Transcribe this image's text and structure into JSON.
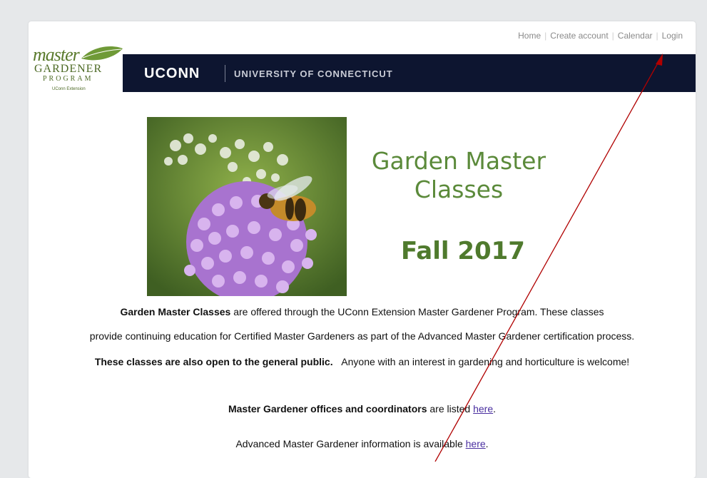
{
  "nav": {
    "home": "Home",
    "create_account": "Create account",
    "calendar": "Calendar",
    "login": "Login",
    "separator": "|"
  },
  "logo": {
    "script": "master",
    "gardener": "GARDENER",
    "program": "PROGRAM",
    "extension": "UConn Extension"
  },
  "brand": {
    "uconn": "UCONN",
    "university": "UNIVERSITY OF CONNECTICUT"
  },
  "hero": {
    "title": "Garden Master Classes",
    "season": "Fall 2017"
  },
  "intro": {
    "line1_bold": "Garden Master Classes",
    "line1_rest": " are offered through the UConn Extension Master Gardener Program. These classes",
    "line2": "provide continuing education for Certified Master Gardeners as part of the Advanced Master Gardener certification process.",
    "line3_bold": "These classes are also open to the general public.",
    "line3_rest": "Anyone with an interest in gardening and horticulture is welcome!"
  },
  "info": {
    "offices_bold": "Master Gardener offices and coordinators",
    "offices_rest": " are listed ",
    "offices_link": "here",
    "offices_end": ".",
    "amg_text": "Advanced Master Gardener information is available ",
    "amg_link": "here",
    "amg_end": "."
  },
  "colors": {
    "title_green": "#5b8a3a",
    "brand_navy": "#0d1530",
    "annotation_arrow": "#b00000"
  }
}
